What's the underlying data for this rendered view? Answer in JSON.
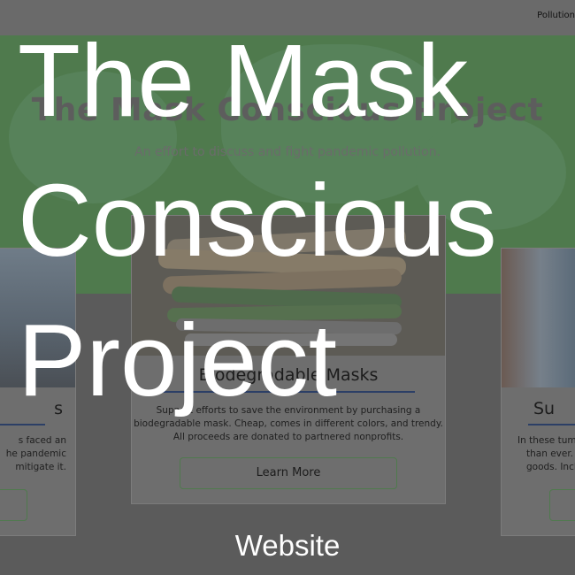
{
  "nav": {
    "pollution_link": "Pollution"
  },
  "hero": {
    "title": "The Mask Conscious Project",
    "subtitle": "An effort to discuss and fight pandemic pollution."
  },
  "cards": {
    "left": {
      "title": "s",
      "text_lines": [
        "s faced an",
        "he pandemic",
        "mitigate it."
      ]
    },
    "center": {
      "title": "Biodegradable Masks",
      "text_lines": [
        "Support efforts to save the environment by purchasing a",
        "biodegradable mask. Cheap, comes in different colors, and trendy.",
        "All proceeds are donated to partnered nonprofits."
      ],
      "button": "Learn More"
    },
    "right": {
      "title": "Su",
      "text_lines": [
        "In these tumul",
        "than ever. He",
        "goods. Includ"
      ]
    }
  },
  "overlay": {
    "title": "The Mask Conscious Project",
    "caption": "Website"
  }
}
